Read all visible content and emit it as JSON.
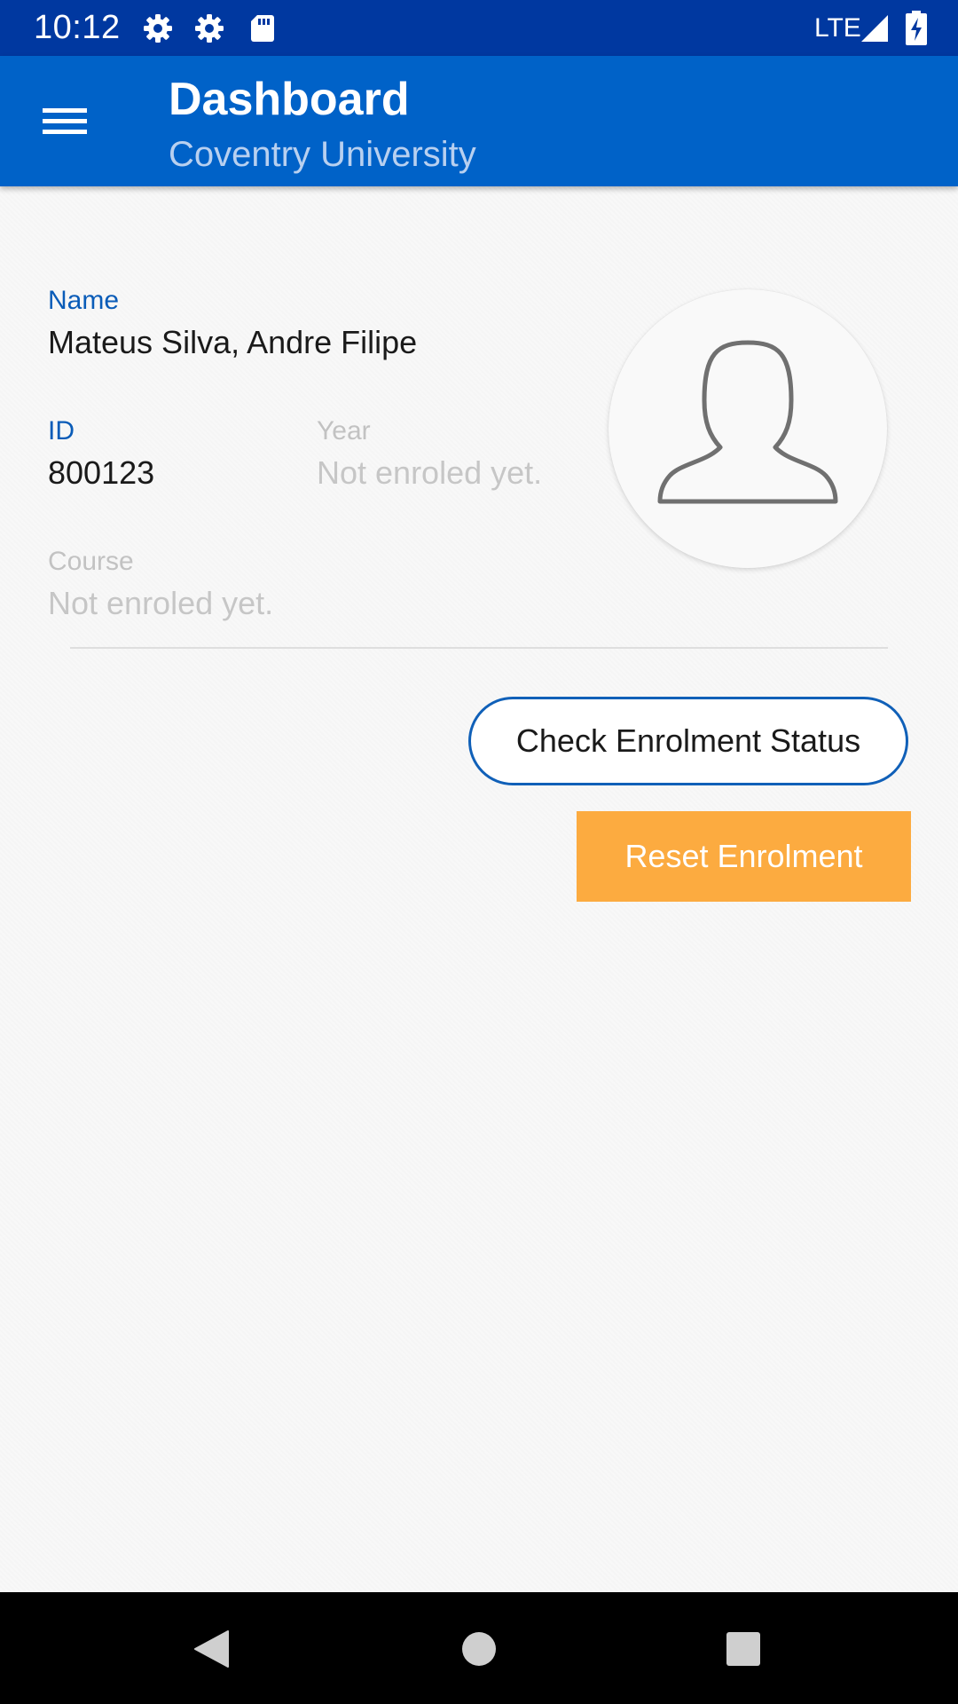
{
  "status_bar": {
    "time": "10:12",
    "icons": [
      "settings-icon",
      "settings-icon",
      "sd-card-icon"
    ],
    "network_label": "LTE",
    "signal_icon": "cell-signal-icon",
    "battery_icon": "battery-charging-icon"
  },
  "app_bar": {
    "menu_icon": "hamburger-menu-icon",
    "title": "Dashboard",
    "subtitle": "Coventry University"
  },
  "profile": {
    "name_label": "Name",
    "name_value": "Mateus Silva, Andre Filipe",
    "id_label": "ID",
    "id_value": "800123",
    "year_label": "Year",
    "year_value": "Not enroled yet.",
    "course_label": "Course",
    "course_value": "Not enroled yet.",
    "avatar_icon": "user-silhouette-icon"
  },
  "actions": {
    "check_status_label": "Check Enrolment Status",
    "reset_label": "Reset Enrolment"
  },
  "nav_bar": {
    "icons": [
      "back-icon",
      "home-icon",
      "recents-icon"
    ]
  },
  "colors": {
    "status_bar": "#0038a0",
    "app_bar": "#0062c8",
    "label_active": "#0a5cb8",
    "muted_text": "#c2c2c2",
    "outline_border": "#1060b8",
    "reset_button": "#fcab40"
  }
}
